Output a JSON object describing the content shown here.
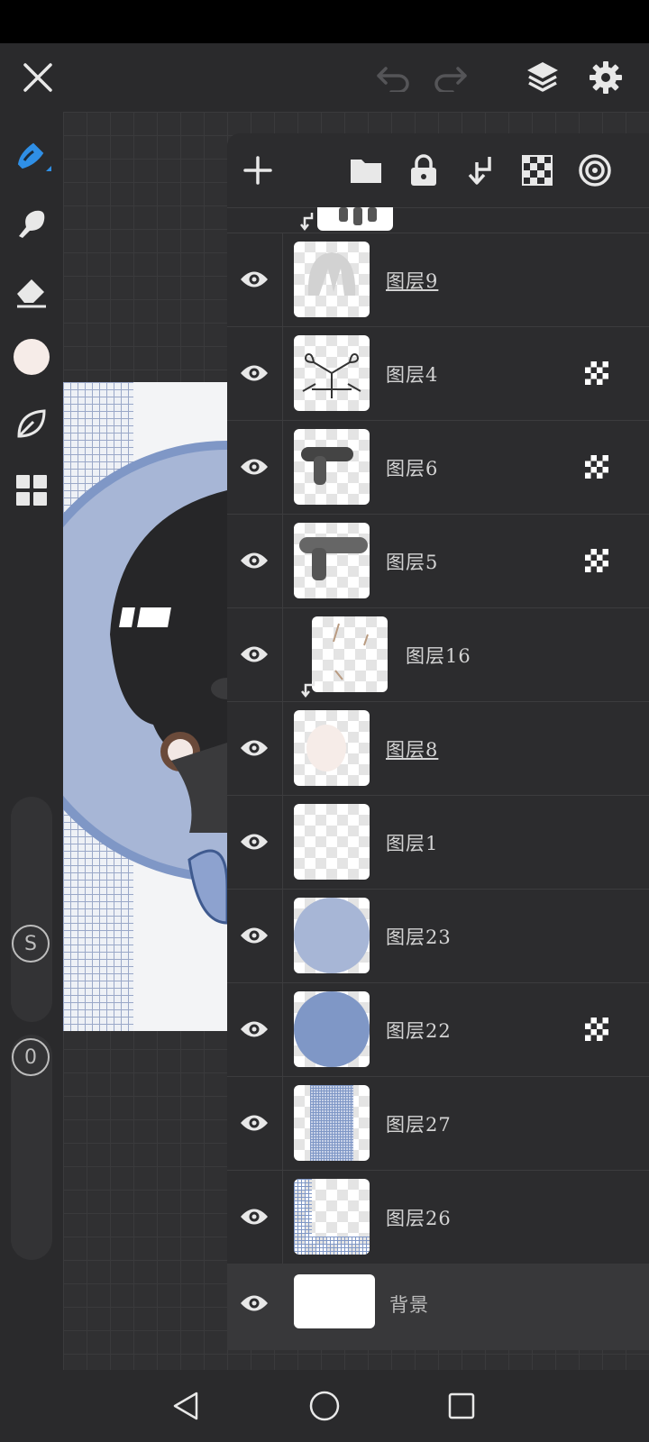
{
  "layers": [
    {
      "name": "图层9",
      "underlined": true,
      "alpha_lock": false,
      "clipped": false
    },
    {
      "name": "图层4",
      "underlined": false,
      "alpha_lock": true,
      "clipped": false
    },
    {
      "name": "图层6",
      "underlined": false,
      "alpha_lock": true,
      "clipped": false
    },
    {
      "name": "图层5",
      "underlined": false,
      "alpha_lock": true,
      "clipped": false
    },
    {
      "name": "图层16",
      "underlined": false,
      "alpha_lock": false,
      "clipped": true
    },
    {
      "name": "图层8",
      "underlined": true,
      "alpha_lock": false,
      "clipped": false
    },
    {
      "name": "图层1",
      "underlined": false,
      "alpha_lock": false,
      "clipped": false
    },
    {
      "name": "图层23",
      "underlined": false,
      "alpha_lock": false,
      "clipped": false
    },
    {
      "name": "图层22",
      "underlined": false,
      "alpha_lock": true,
      "clipped": false
    },
    {
      "name": "图层27",
      "underlined": false,
      "alpha_lock": false,
      "clipped": false
    },
    {
      "name": "图层26",
      "underlined": false,
      "alpha_lock": false,
      "clipped": false
    },
    {
      "name": "背景",
      "underlined": false,
      "alpha_lock": false,
      "clipped": false
    }
  ],
  "sidebar": {
    "brush_size_label": "S",
    "opacity_label": "0",
    "current_color": "#f6ece8"
  },
  "colors": {
    "accent": "#2f8fe6",
    "canvas_blue_light": "#a7b6d6",
    "canvas_blue": "#7f97c6"
  }
}
